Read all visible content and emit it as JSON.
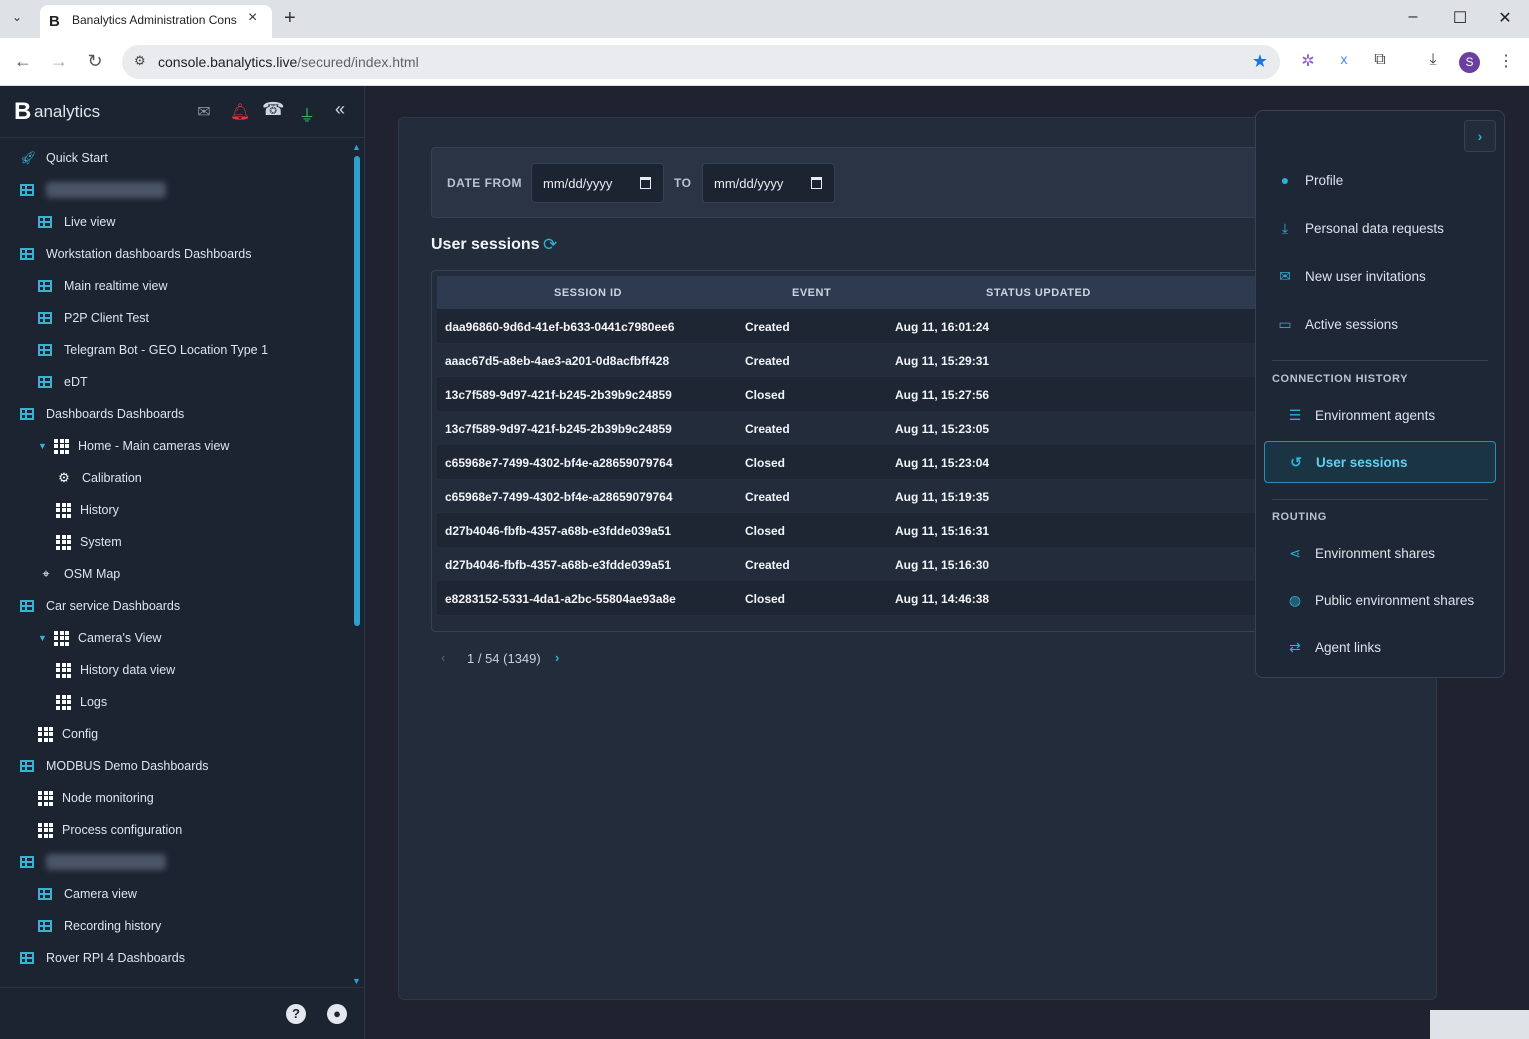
{
  "browser": {
    "tab_title": "Banalytics Administration Cons",
    "favicon_letter": "B",
    "url_host": "console.banalytics.live",
    "url_path": "/secured/index.html",
    "avatar_letter": "S"
  },
  "sidebar": {
    "logo_letter": "B",
    "logo_text": "analytics",
    "tree": [
      {
        "label": "Quick Start",
        "icon": "rocket-icon",
        "level": 0
      },
      {
        "label": "",
        "icon": "table-icon",
        "level": 0,
        "blurred": true
      },
      {
        "label": "Live view",
        "icon": "table-icon",
        "level": 1
      },
      {
        "label": "Workstation dashboards Dashboards",
        "icon": "table-icon",
        "level": 0
      },
      {
        "label": "Main realtime view",
        "icon": "table-icon",
        "level": 1
      },
      {
        "label": "P2P Client Test",
        "icon": "table-icon",
        "level": 1
      },
      {
        "label": "Telegram Bot - GEO Location Type 1",
        "icon": "table-icon",
        "level": 1
      },
      {
        "label": "eDT",
        "icon": "table-icon",
        "level": 1
      },
      {
        "label": "Dashboards Dashboards",
        "icon": "table-icon",
        "level": 0
      },
      {
        "label": "Home - Main cameras view",
        "icon": "grid-icon",
        "level": 1,
        "expanded": true
      },
      {
        "label": "Calibration",
        "icon": "gear-icon",
        "level": 2
      },
      {
        "label": "History",
        "icon": "grid-icon",
        "level": 2
      },
      {
        "label": "System",
        "icon": "grid-icon",
        "level": 2
      },
      {
        "label": "OSM Map",
        "icon": "map-icon",
        "level": 1
      },
      {
        "label": "Car service Dashboards",
        "icon": "table-icon",
        "level": 0
      },
      {
        "label": "Camera's View",
        "icon": "grid-icon",
        "level": 1,
        "expanded": true
      },
      {
        "label": "History data view",
        "icon": "grid-icon",
        "level": 2
      },
      {
        "label": "Logs",
        "icon": "grid-icon",
        "level": 2
      },
      {
        "label": "Config",
        "icon": "grid-icon",
        "level": 1
      },
      {
        "label": "MODBUS Demo Dashboards",
        "icon": "table-icon",
        "level": 0
      },
      {
        "label": "Node monitoring",
        "icon": "grid-icon",
        "level": 1
      },
      {
        "label": "Process configuration",
        "icon": "grid-icon",
        "level": 1
      },
      {
        "label": "",
        "icon": "table-icon",
        "level": 0,
        "blurred": true
      },
      {
        "label": "Camera view",
        "icon": "table-icon",
        "level": 1
      },
      {
        "label": "Recording history",
        "icon": "table-icon",
        "level": 1
      },
      {
        "label": "Rover RPI 4 Dashboards",
        "icon": "table-icon",
        "level": 0
      }
    ]
  },
  "filter": {
    "date_from_label": "DATE FROM",
    "to_label": "TO",
    "date_from_placeholder": "mm/dd/yyyy",
    "date_to_placeholder": "mm/dd/yyyy"
  },
  "sessions": {
    "title": "User sessions",
    "columns": [
      "SESSION ID",
      "EVENT",
      "STATUS UPDATED"
    ],
    "rows": [
      [
        "daa96860-9d6d-41ef-b633-0441c7980ee6",
        "Created",
        "Aug 11, 16:01:24"
      ],
      [
        "aaac67d5-a8eb-4ae3-a201-0d8acfbff428",
        "Created",
        "Aug 11, 15:29:31"
      ],
      [
        "13c7f589-9d97-421f-b245-2b39b9c24859",
        "Closed",
        "Aug 11, 15:27:56"
      ],
      [
        "13c7f589-9d97-421f-b245-2b39b9c24859",
        "Created",
        "Aug 11, 15:23:05"
      ],
      [
        "c65968e7-7499-4302-bf4e-a28659079764",
        "Closed",
        "Aug 11, 15:23:04"
      ],
      [
        "c65968e7-7499-4302-bf4e-a28659079764",
        "Created",
        "Aug 11, 15:19:35"
      ],
      [
        "d27b4046-fbfb-4357-a68b-e3fdde039a51",
        "Closed",
        "Aug 11, 15:16:31"
      ],
      [
        "d27b4046-fbfb-4357-a68b-e3fdde039a51",
        "Created",
        "Aug 11, 15:16:30"
      ],
      [
        "e8283152-5331-4da1-a2bc-55804ae93a8e",
        "Closed",
        "Aug 11, 14:46:38"
      ]
    ],
    "pager": "1 / 54 (1349)"
  },
  "user_menu": {
    "items": [
      {
        "label": "Profile",
        "icon": "user-circle-icon"
      },
      {
        "label": "Personal data requests",
        "icon": "download-icon"
      },
      {
        "label": "New user invitations",
        "icon": "envelope-icon"
      },
      {
        "label": "Active sessions",
        "icon": "monitor-icon"
      }
    ],
    "connection_history_heading": "CONNECTION HISTORY",
    "connection_items": [
      {
        "label": "Environment agents",
        "icon": "server-icon"
      },
      {
        "label": "User sessions",
        "icon": "history-icon",
        "selected": true
      }
    ],
    "routing_heading": "ROUTING",
    "routing_items": [
      {
        "label": "Environment shares",
        "icon": "share-icon"
      },
      {
        "label": "Public environment shares",
        "icon": "globe-icon"
      },
      {
        "label": "Agent links",
        "icon": "arrows-icon"
      }
    ]
  },
  "colors": {
    "accent": "#2fb0d6",
    "sidebar_bg": "#1c2431",
    "panel_bg": "#222c3b",
    "alert_red": "#e53935",
    "plug_green": "#3ec46d"
  }
}
